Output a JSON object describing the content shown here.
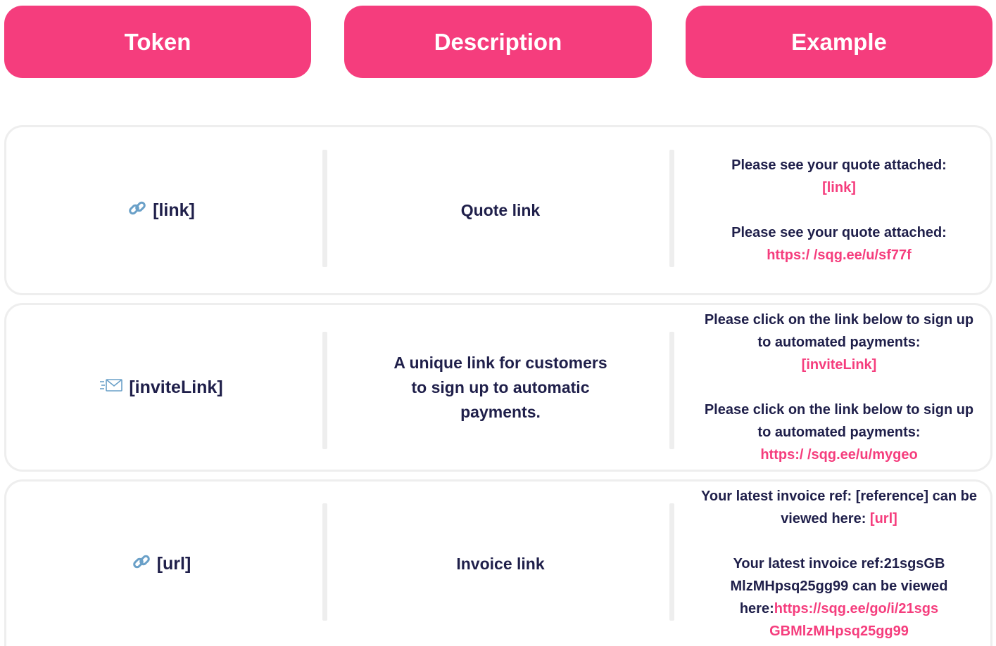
{
  "headers": {
    "token": "Token",
    "description": "Description",
    "example": "Example"
  },
  "colors": {
    "accent": "#f53d7d",
    "text": "#1f1f4a",
    "border": "#eeeeee"
  },
  "rows": [
    {
      "icon": "link-icon",
      "token": "[link]",
      "description": "Quote link",
      "example_template_text": "Please see your quote attached:",
      "example_template_token": "[link]",
      "example_result_text": "Please see your quote attached:",
      "example_result_link": "https:/ /sqg.ee/u/sf77f"
    },
    {
      "icon": "envelope-icon",
      "token": "[inviteLink]",
      "description": "A unique link for customers to sign up to automatic payments.",
      "example_template_text": "Please click on the link below to sign up to automated payments:",
      "example_template_token": "[inviteLink]",
      "example_result_text": "Please click on the link below to sign up to automated payments:",
      "example_result_link": "https:/ /sqg.ee/u/mygeo"
    },
    {
      "icon": "link-icon",
      "token": "[url]",
      "description": "Invoice link",
      "example_template_text": "Your latest invoice ref: [reference] can be viewed here:",
      "example_template_token": "[url]",
      "example_result_text": "Your latest invoice ref:21sgsGB MlzMHpsq25gg99 can be viewed here:",
      "example_result_link": "https://sqg.ee/go/i/21sgs GBMlzMHpsq25gg99"
    }
  ]
}
